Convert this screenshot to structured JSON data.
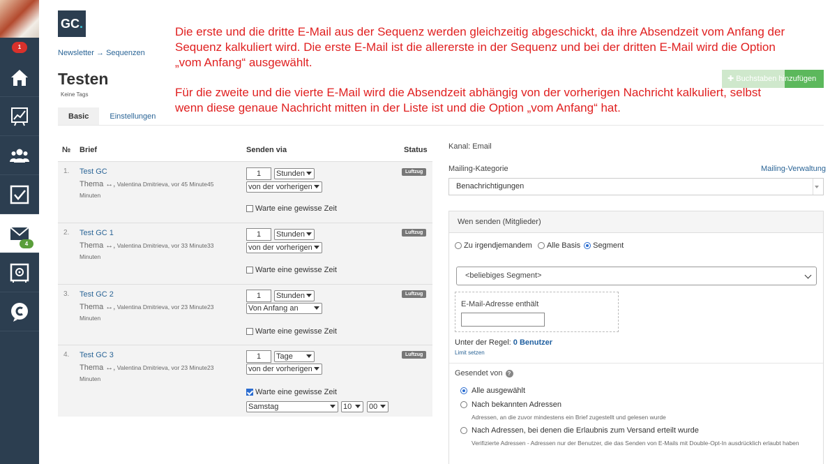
{
  "sidebar": {
    "notification_count": "1",
    "mail_count": "4",
    "items": [
      {
        "name": "home-icon"
      },
      {
        "name": "chart-icon"
      },
      {
        "name": "users-icon"
      },
      {
        "name": "checkbox-icon"
      },
      {
        "name": "mail-icon"
      },
      {
        "name": "safe-icon"
      },
      {
        "name": "brand-c-icon"
      }
    ]
  },
  "header": {
    "logo_text": "GC",
    "logo_dot": ".",
    "breadcrumb": "Newsletter → Sequenzen",
    "title": "Testen",
    "tags": "Keine Tags",
    "tabs": [
      "Basic",
      "Einstellungen"
    ],
    "add_button": "✚ Buchstaben hinzufügen"
  },
  "annotation": {
    "line1": "Die erste und die dritte E-Mail aus der Sequenz werden gleichzeitig abgeschickt, da ihre Absendzeit vom Anfang der Sequenz kalkuliert wird. Die erste E-Mail ist die allererste in der Sequenz und bei der dritten E-Mail wird die Option „vom Anfang“ ausgewählt.",
    "line2": "Für die zweite und die vierte E-Mail wird die Absendzeit abhängig von der vorherigen Nachricht kalkuliert, selbst wenn diese genaue Nachricht mitten in der Liste ist und die Option „vom Anfang“ hat."
  },
  "table": {
    "headers": {
      "num": "№",
      "letter": "Brief",
      "via": "Senden via",
      "status": "Status"
    },
    "rows": [
      {
        "num": "1.",
        "name": "Test GC",
        "thema": "Thema ↔,",
        "meta": " Valentina Dmitrieva, vor 45 Minute45 Minuten",
        "count": "1",
        "unit": "Stunden",
        "relative": "von der vorherigen",
        "wait": "Warte eine gewisse Zeit",
        "wait_checked": false,
        "status": "Luftzug"
      },
      {
        "num": "2.",
        "name": "Test GC 1",
        "thema": "Thema ↔,",
        "meta": " Valentina Dmitrieva, vor 33 Minute33 Minuten",
        "count": "1",
        "unit": "Stunden",
        "relative": "von der vorherigen",
        "wait": "Warte eine gewisse Zeit",
        "wait_checked": false,
        "status": "Luftzug"
      },
      {
        "num": "3.",
        "name": "Test GC 2",
        "thema": "Thema ↔,",
        "meta": " Valentina Dmitrieva, vor 23 Minute23 Minuten",
        "count": "1",
        "unit": "Stunden",
        "relative": "Von Anfang an",
        "wait": "Warte eine gewisse Zeit",
        "wait_checked": false,
        "status": "Luftzug"
      },
      {
        "num": "4.",
        "name": "Test GC 3",
        "thema": "Thema ↔,",
        "meta": " Valentina Dmitrieva, vor 23 Minute23 Minuten",
        "count": "1",
        "unit": "Tage",
        "relative": "von der vorherigen",
        "wait": "Warte eine gewisse Zeit",
        "wait_checked": true,
        "day": "Samstag",
        "hour": "10",
        "minute": "00",
        "status": "Luftzug"
      }
    ]
  },
  "right": {
    "kanal": "Kanal: Email",
    "mailing_label": "Mailing-Kategorie",
    "mailing_link": "Mailing-Verwaltung",
    "mailing_value": "Benachrichtigungen",
    "panel_title": "Wen senden (Mitglieder)",
    "radio": [
      "Zu irgendjemandem",
      "Alle Basis",
      "Segment"
    ],
    "segment_value": "<beliebiges Segment>",
    "email_contains": "E-Mail-Adresse enthält",
    "rule_text": "Unter der Regel:",
    "rule_count": "0 Benutzer",
    "limit": "Limit setzen",
    "sent_from": "Gesendet von",
    "help": "?",
    "options": [
      {
        "label": "Alle ausgewählt",
        "desc": ""
      },
      {
        "label": "Nach bekannten Adressen",
        "desc": "Adressen, an die zuvor mindestens ein Brief zugestellt und gelesen wurde"
      },
      {
        "label": "Nach Adressen, bei denen die Erlaubnis zum Versand erteilt wurde",
        "desc": "Verifizierte Adressen - Adressen nur der Benutzer, die das Senden von E-Mails mit Double-Opt-In ausdrücklich erlaubt haben"
      }
    ]
  },
  "colors": {
    "sidebar": "#2c3e50",
    "annotation": "#e02020",
    "link": "#2a6496",
    "status": "#777777",
    "add_button": "#5cb85c"
  }
}
